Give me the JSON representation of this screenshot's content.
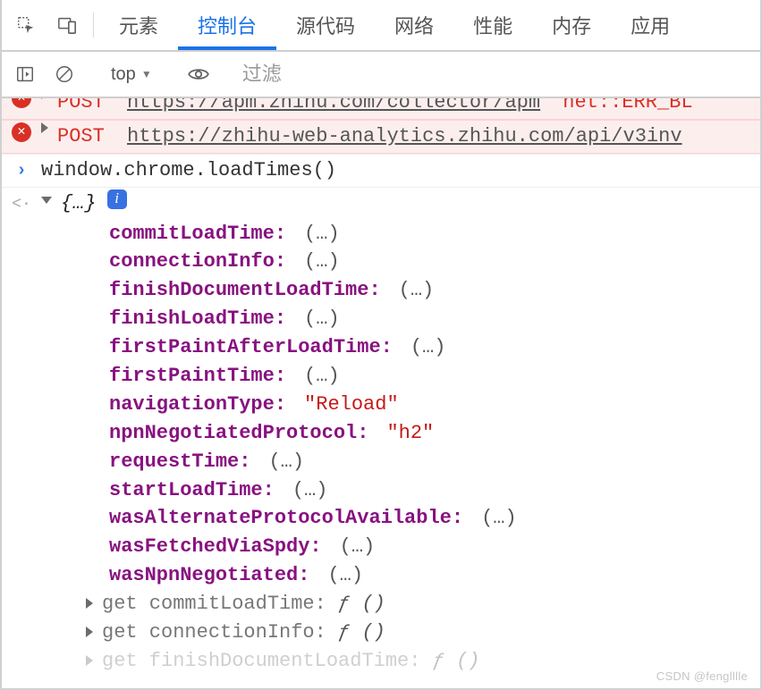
{
  "tabs": {
    "elements": "元素",
    "console": "控制台",
    "sources": "源代码",
    "network": "网络",
    "performance": "性能",
    "memory": "内存",
    "application": "应用"
  },
  "subbar": {
    "context": "top",
    "filter_placeholder": "过滤"
  },
  "errors": [
    {
      "method": "POST",
      "url": "https://apm.zhihu.com/collector/apm",
      "err": "net::ERR_BL"
    },
    {
      "method": "POST",
      "url": "https://zhihu-web-analytics.zhihu.com/api/v3inv",
      "err": ""
    }
  ],
  "prompt": "window.chrome.loadTimes()",
  "result": {
    "head": "{…}",
    "props": [
      {
        "key": "commitLoadTime",
        "val": "(…)"
      },
      {
        "key": "connectionInfo",
        "val": "(…)"
      },
      {
        "key": "finishDocumentLoadTime",
        "val": "(…)"
      },
      {
        "key": "finishLoadTime",
        "val": "(…)"
      },
      {
        "key": "firstPaintAfterLoadTime",
        "val": "(…)"
      },
      {
        "key": "firstPaintTime",
        "val": "(…)"
      },
      {
        "key": "navigationType",
        "val": "\"Reload\"",
        "type": "string"
      },
      {
        "key": "npnNegotiatedProtocol",
        "val": "\"h2\"",
        "type": "string"
      },
      {
        "key": "requestTime",
        "val": "(…)"
      },
      {
        "key": "startLoadTime",
        "val": "(…)"
      },
      {
        "key": "wasAlternateProtocolAvailable",
        "val": "(…)"
      },
      {
        "key": "wasFetchedViaSpdy",
        "val": "(…)"
      },
      {
        "key": "wasNpnNegotiated",
        "val": "(…)"
      }
    ],
    "getters": [
      "get commitLoadTime",
      "get connectionInfo",
      "get finishDocumentLoadTime"
    ],
    "fn_sig": "ƒ ()"
  },
  "watermark": "CSDN @fenglllle"
}
